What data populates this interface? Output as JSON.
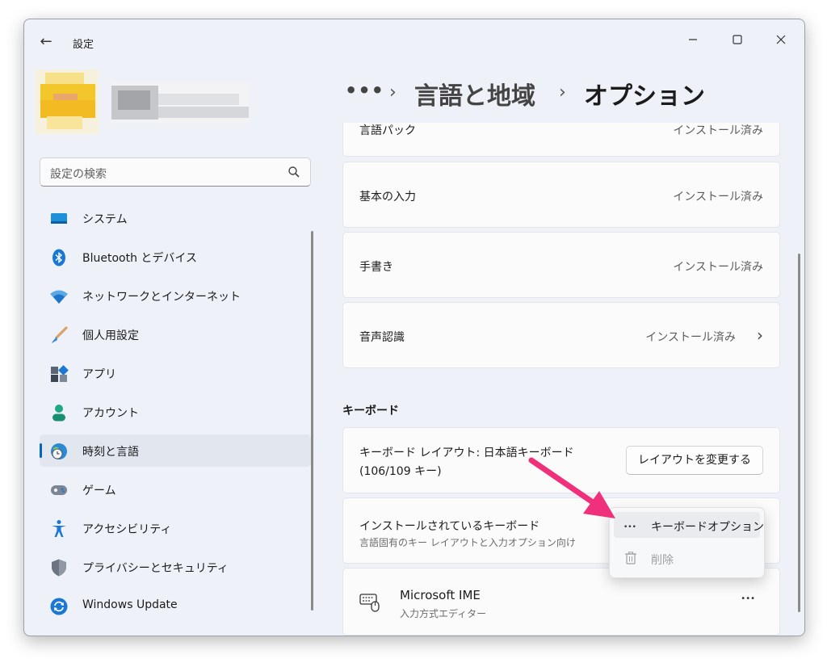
{
  "window": {
    "title": "設定",
    "back_glyph": "←"
  },
  "search": {
    "placeholder": "設定の検索"
  },
  "nav": {
    "items": [
      {
        "label": "システム",
        "icon": "system-icon"
      },
      {
        "label": "Bluetooth とデバイス",
        "icon": "bluetooth-icon"
      },
      {
        "label": "ネットワークとインターネット",
        "icon": "wifi-icon"
      },
      {
        "label": "個人用設定",
        "icon": "brush-icon"
      },
      {
        "label": "アプリ",
        "icon": "apps-icon"
      },
      {
        "label": "アカウント",
        "icon": "account-icon"
      },
      {
        "label": "時刻と言語",
        "icon": "time-language-icon",
        "selected": true
      },
      {
        "label": "ゲーム",
        "icon": "gamepad-icon"
      },
      {
        "label": "アクセシビリティ",
        "icon": "accessibility-icon"
      },
      {
        "label": "プライバシーとセキュリティ",
        "icon": "shield-icon"
      },
      {
        "label": "Windows Update",
        "icon": "windows-update-icon"
      }
    ]
  },
  "breadcrumb": {
    "more": "•••",
    "sep": "›",
    "items": [
      "言語と地域",
      "オプション"
    ]
  },
  "features": [
    {
      "label": "言語パック",
      "status": "インストール済み"
    },
    {
      "label": "基本の入力",
      "status": "インストール済み"
    },
    {
      "label": "手書き",
      "status": "インストール済み"
    },
    {
      "label": "音声認識",
      "status": "インストール済み",
      "chevron": "›"
    }
  ],
  "keyboard": {
    "section_title": "キーボード",
    "layout_line1": "キーボード レイアウト: 日本語キーボード",
    "layout_line2": "(106/109 キー)",
    "change_layout_button": "レイアウトを変更する",
    "installed_title": "インストールされているキーボード",
    "installed_sub": "言語固有のキー レイアウトと入力オプション向け",
    "ime_name": "Microsoft IME",
    "ime_sub": "入力方式エディター",
    "ime_more": "•••"
  },
  "menu": {
    "options_glyph": "•••",
    "options_label": "キーボードオプション",
    "delete_label": "削除"
  },
  "colors": {
    "accent": "#0067c0",
    "annotation_arrow": "#f0307a"
  }
}
